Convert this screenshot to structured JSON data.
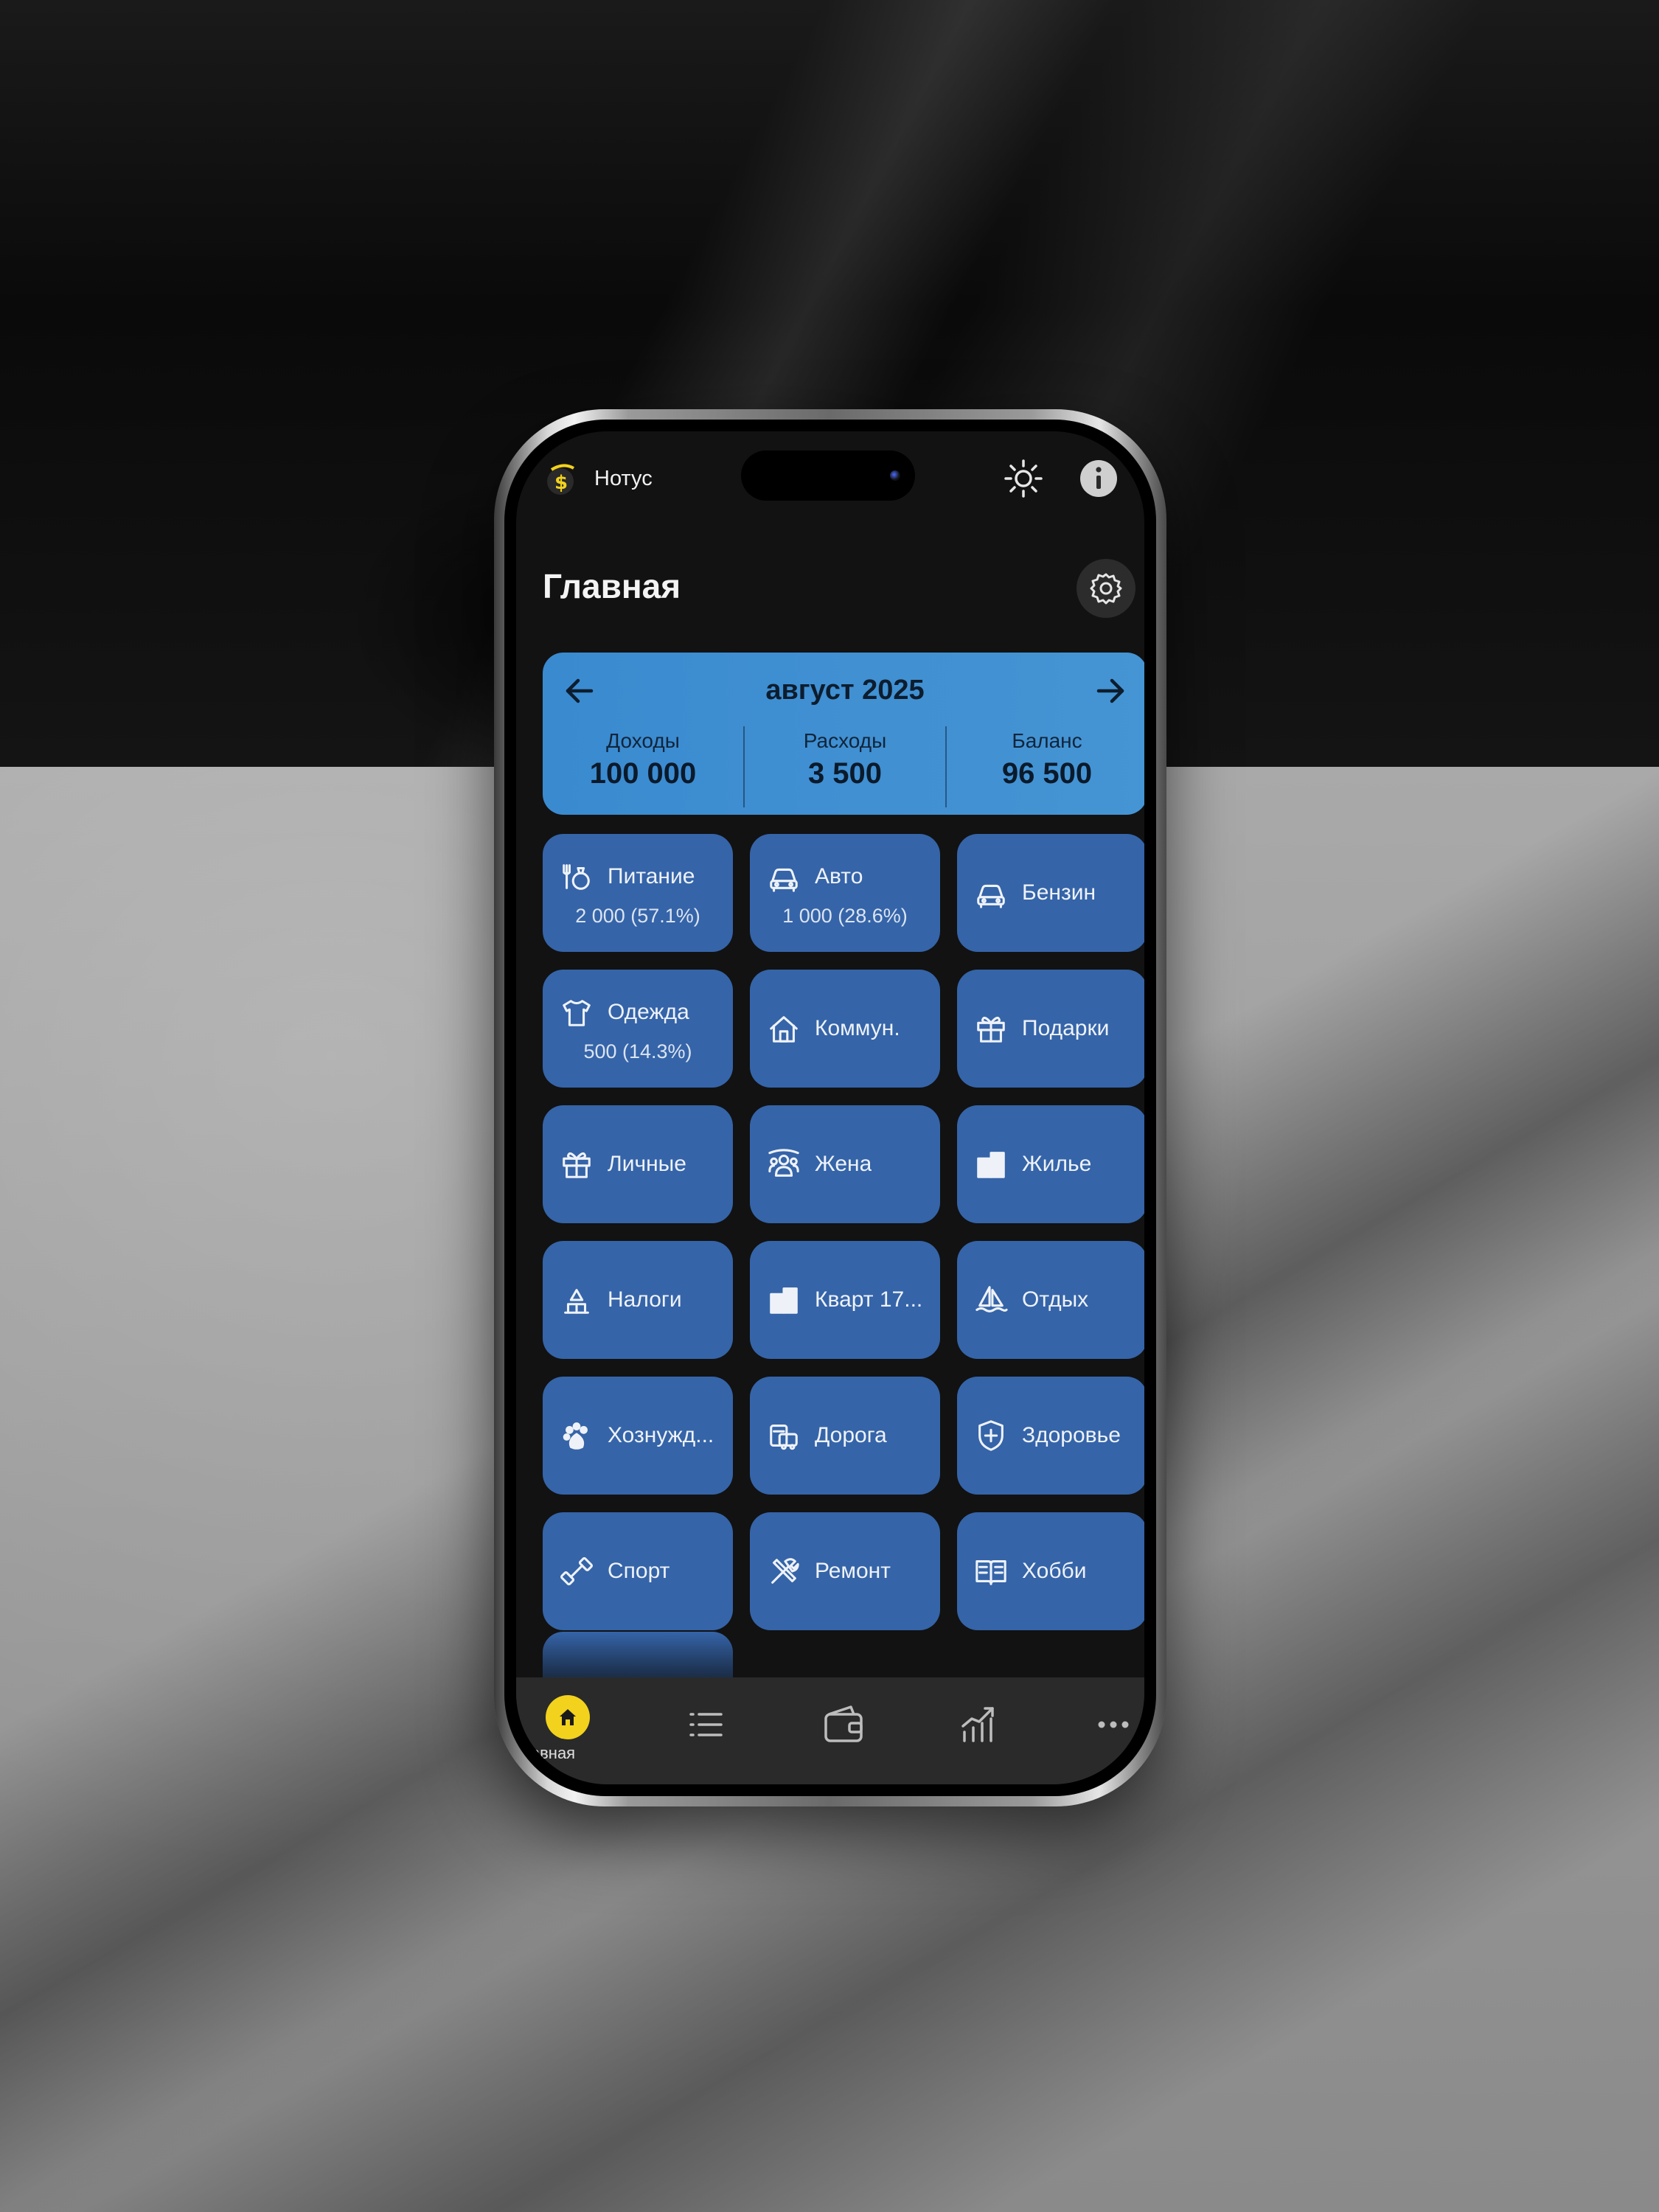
{
  "app": {
    "name": "Нотус",
    "page_title": "Главная"
  },
  "summary": {
    "month": "август 2025",
    "income_label": "Доходы",
    "income_value": "100 000",
    "expense_label": "Расходы",
    "expense_value": "3 500",
    "balance_label": "Баланс",
    "balance_value": "96 500"
  },
  "categories": [
    {
      "label": "Питание",
      "sub": "2 000 (57.1%)",
      "icon": "food-icon"
    },
    {
      "label": "Авто",
      "sub": "1 000 (28.6%)",
      "icon": "car-icon"
    },
    {
      "label": "Бензин",
      "sub": "",
      "icon": "car-icon"
    },
    {
      "label": "Одежда",
      "sub": "500 (14.3%)",
      "icon": "tshirt-icon"
    },
    {
      "label": "Коммун.",
      "sub": "",
      "icon": "house-icon"
    },
    {
      "label": "Подарки",
      "sub": "",
      "icon": "gift-icon"
    },
    {
      "label": "Личные",
      "sub": "",
      "icon": "gift-icon"
    },
    {
      "label": "Жена",
      "sub": "",
      "icon": "people-icon"
    },
    {
      "label": "Жилье",
      "sub": "",
      "icon": "building-icon"
    },
    {
      "label": "Налоги",
      "sub": "",
      "icon": "bank-icon"
    },
    {
      "label": "Кварт 17...",
      "sub": "",
      "icon": "building-icon"
    },
    {
      "label": "Отдых",
      "sub": "",
      "icon": "sailboat-icon"
    },
    {
      "label": "Хознужд...",
      "sub": "",
      "icon": "paw-icon"
    },
    {
      "label": "Дорога",
      "sub": "",
      "icon": "transport-icon"
    },
    {
      "label": "Здоровье",
      "sub": "",
      "icon": "shield-plus-icon"
    },
    {
      "label": "Спорт",
      "sub": "",
      "icon": "dumbbell-icon"
    },
    {
      "label": "Ремонт",
      "sub": "",
      "icon": "tools-icon"
    },
    {
      "label": "Хобби",
      "sub": "",
      "icon": "book-icon"
    }
  ],
  "bottom_nav": {
    "home_label": "авная"
  },
  "colors": {
    "accent": "#f2d21c",
    "summary_card": "#3f8fd2",
    "tile": "#3564a8",
    "screen_bg": "#121212",
    "nav_bg": "#2a2a2a"
  }
}
